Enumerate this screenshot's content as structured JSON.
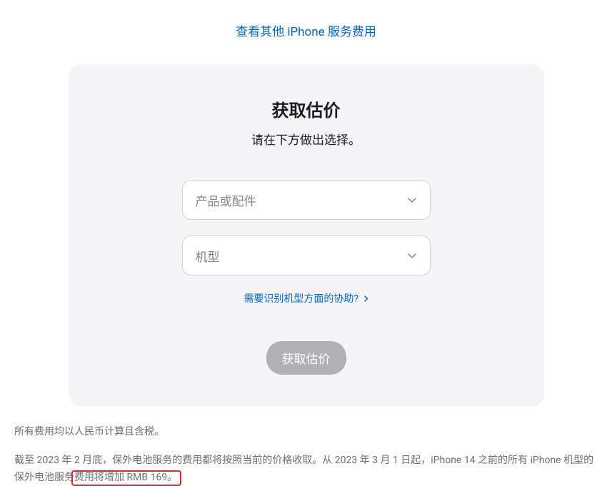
{
  "header": {
    "view_other_link": "查看其他 iPhone 服务费用"
  },
  "card": {
    "title": "获取估价",
    "subtitle": "请在下方做出选择。",
    "product_dropdown": {
      "placeholder": "产品或配件"
    },
    "model_dropdown": {
      "placeholder": "机型"
    },
    "help_link": "需要识别机型方面的协助?",
    "submit_button": "获取估价"
  },
  "footer": {
    "line1": "所有费用均以人民币计算且含税。",
    "line2_part1": "截至 2023 年 2 月底，保外电池服务的费用都将按照当前的价格收取。从 2023 年 3 月 1 日起，iPhone 14 之前的所有 iPhone 机型的保外电池服务",
    "line2_highlight": "费用将增加 RMB 169。"
  }
}
